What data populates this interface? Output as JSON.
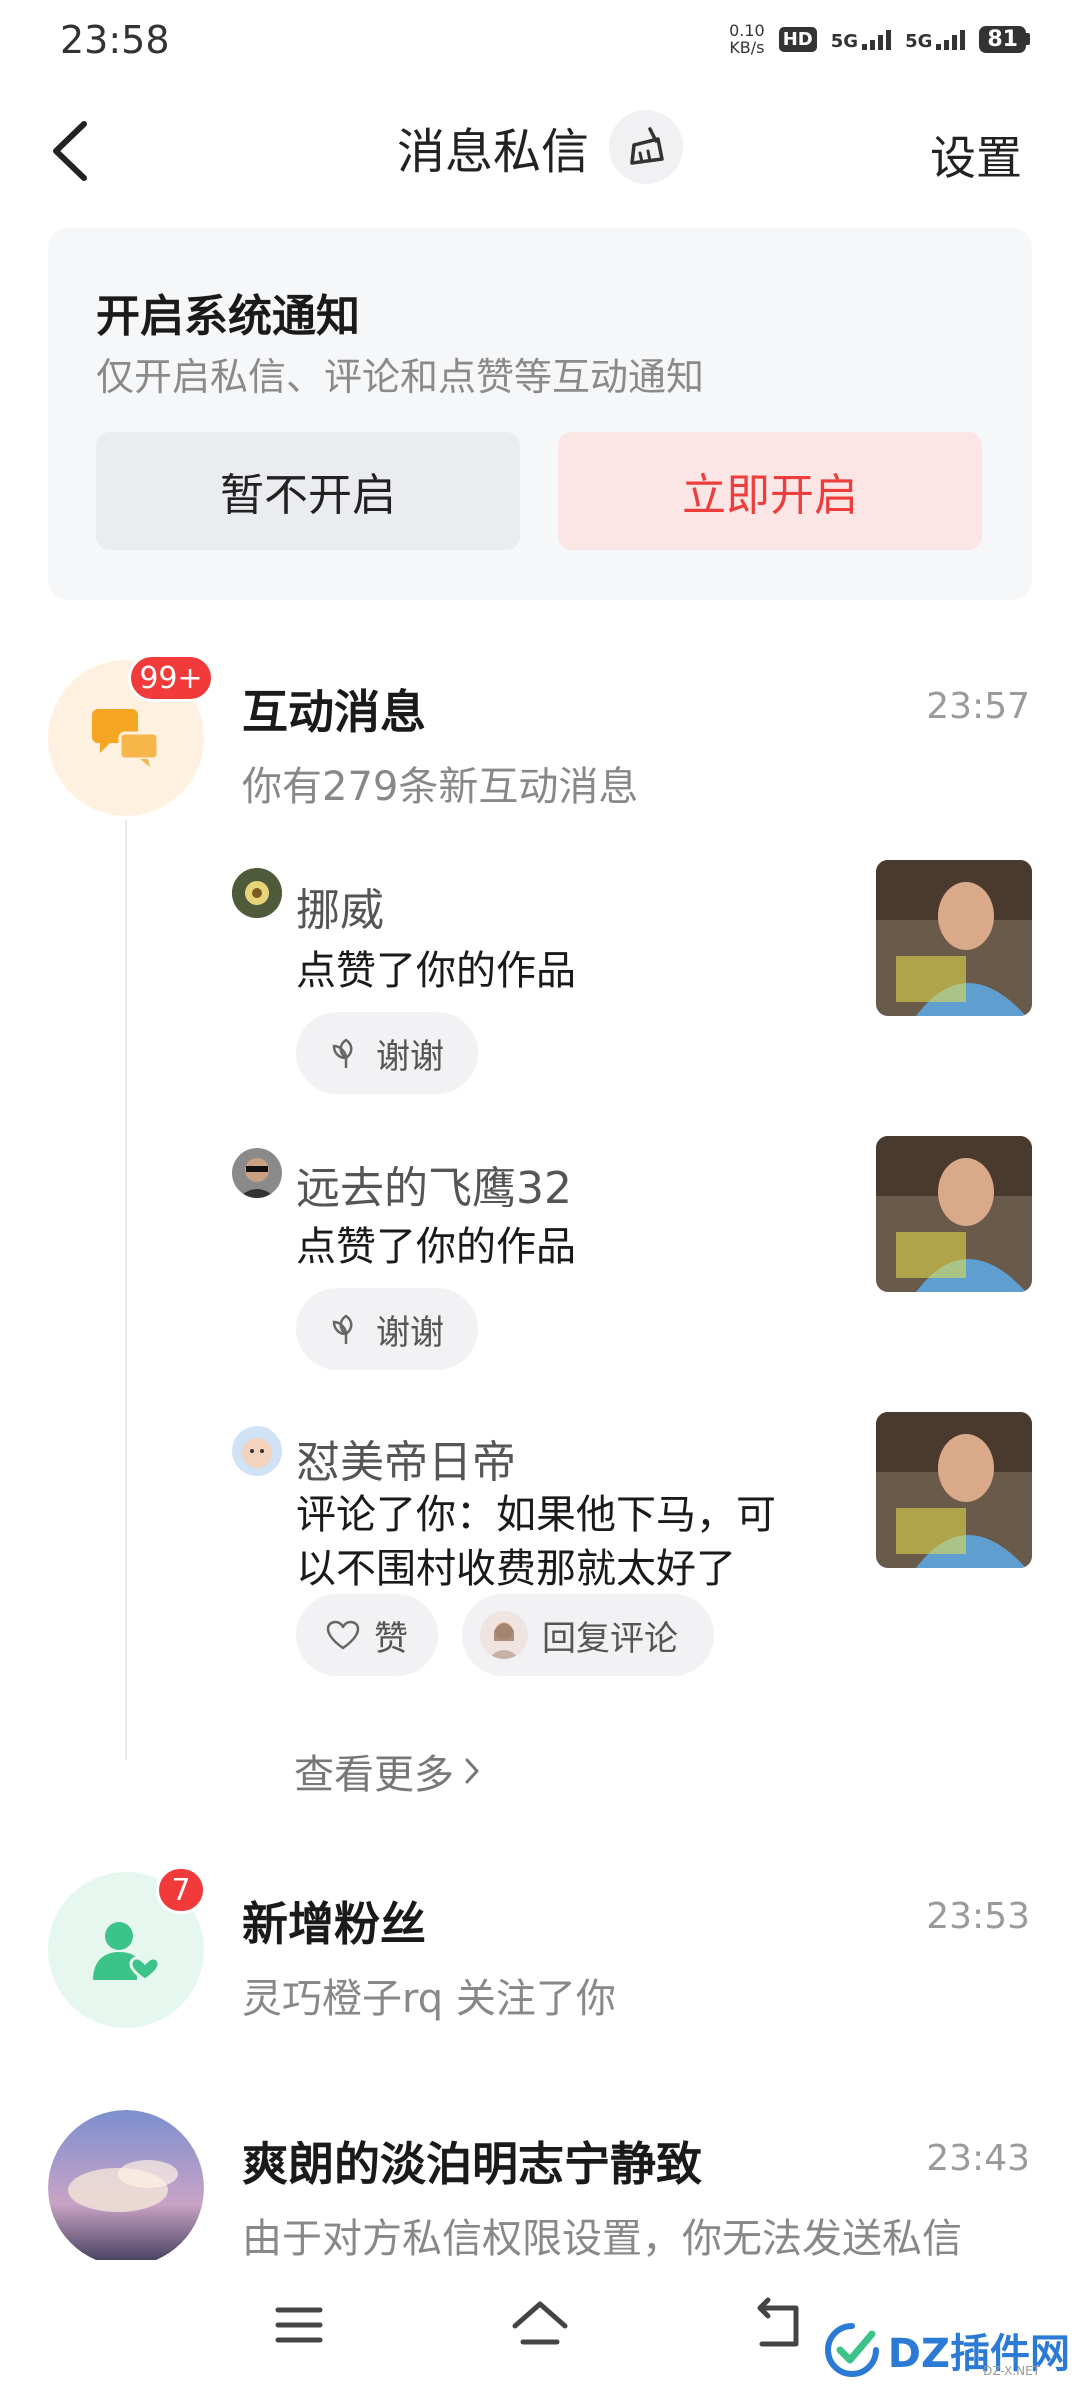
{
  "status_bar": {
    "time": "23:58",
    "net_speed_value": "0.10",
    "net_speed_unit": "KB/s",
    "hd_label": "HD",
    "sim1": "5G",
    "sim2": "5G",
    "battery": "81"
  },
  "nav": {
    "title": "消息私信",
    "settings_label": "设置"
  },
  "notification_card": {
    "title": "开启系统通知",
    "subtitle": "仅开启私信、评论和点赞等互动通知",
    "later_label": "暂不开启",
    "open_label": "立即开启"
  },
  "interactions": {
    "title": "互动消息",
    "badge": "99+",
    "time": "23:57",
    "subtitle": "你有279条新互动消息",
    "items": [
      {
        "user": "挪威",
        "text": "点赞了你的作品",
        "buttons": [
          "谢谢"
        ]
      },
      {
        "user": "远去的飞鹰32",
        "text": "点赞了你的作品",
        "buttons": [
          "谢谢"
        ]
      },
      {
        "user": "怼美帝日帝",
        "text_line1": "评论了你：如果他下马，可",
        "text_line2": "以不围村收费那就太好了",
        "buttons": [
          "赞",
          "回复评论"
        ]
      }
    ],
    "see_more": "查看更多"
  },
  "new_fans": {
    "title": "新增粉丝",
    "badge": "7",
    "time": "23:53",
    "subtitle": "灵巧橙子rq 关注了你"
  },
  "chat": {
    "title": "爽朗的淡泊明志宁静致",
    "time": "23:43",
    "subtitle": "由于对方私信权限设置，你无法发送私信"
  },
  "watermark": {
    "brand": "DZ插件网",
    "sub": "DZ-X.NET"
  },
  "colors": {
    "accent_red": "#ee3d3d",
    "badge_red": "#f23a3a",
    "interaction_bg": "#fff1e0",
    "interaction_icon": "#f5a623",
    "fans_bg": "#e6f7ef",
    "fans_icon": "#3cc38a"
  }
}
